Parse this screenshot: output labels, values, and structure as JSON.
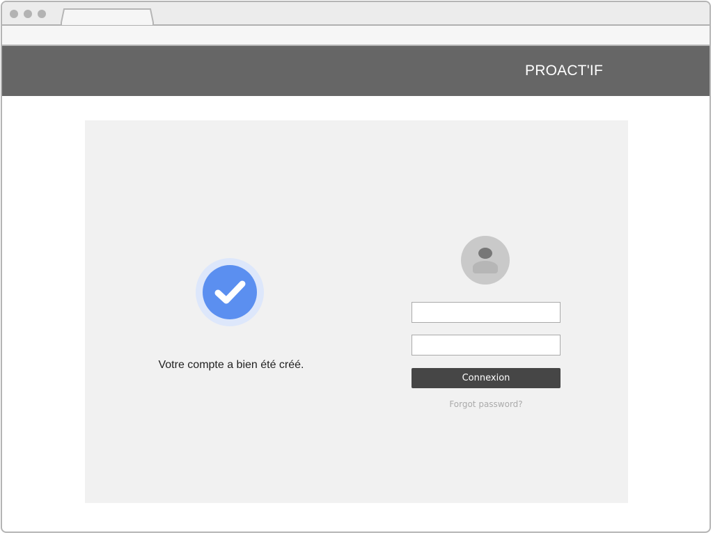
{
  "browser": {
    "tab_title": "",
    "address": ""
  },
  "header": {
    "brand": "PROACT'IF",
    "background_color": "#666666"
  },
  "success": {
    "icon": "check-circle-icon",
    "icon_color": "#5b8ff0",
    "message": "Votre compte a bien été créé."
  },
  "login": {
    "avatar_icon": "user-avatar-icon",
    "username_value": "",
    "password_value": "",
    "submit_label": "Connexion",
    "forgot_label": "Forgot password?"
  }
}
